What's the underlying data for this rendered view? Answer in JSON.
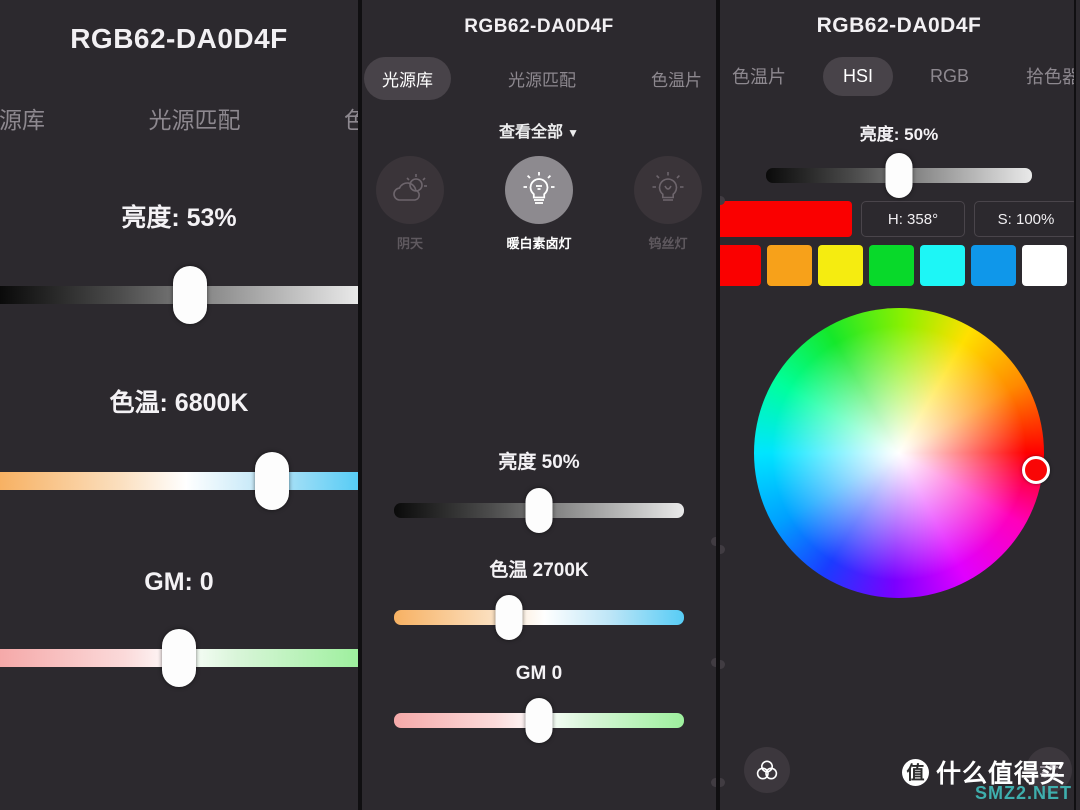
{
  "app": {
    "device_name": "RGB62-DA0D4F",
    "background": "#2c292e",
    "accent": "#f90606"
  },
  "panel1": {
    "title": "RGB62-DA0D4F",
    "tabs": [
      {
        "label": "光源库",
        "active": false
      },
      {
        "label": "光源匹配",
        "active": false
      },
      {
        "label": "色温",
        "active": false
      }
    ],
    "sliders": [
      {
        "name": "brightness",
        "label": "亮度: 53%",
        "value": 53,
        "unit": "%",
        "track": "brightness"
      },
      {
        "name": "cct",
        "label": "色温: 6800K",
        "value": 6800,
        "unit": "K",
        "track": "cct"
      },
      {
        "name": "gm",
        "label": "GM: 0",
        "value": 0,
        "unit": "",
        "track": "gm"
      }
    ]
  },
  "panel2": {
    "title": "RGB62-DA0D4F",
    "tabs": [
      {
        "label": "光源库",
        "active": true
      },
      {
        "label": "光源匹配",
        "active": false
      },
      {
        "label": "色温片",
        "active": false
      }
    ],
    "view_all": "查看全部",
    "view_all_caret": "▼",
    "presets": [
      {
        "label": "阴天",
        "icon": "cloudy-sun-icon",
        "selected": false
      },
      {
        "label": "暖白素卤灯",
        "icon": "bulb-icon",
        "selected": true
      },
      {
        "label": "钨丝灯",
        "icon": "tungsten-bulb-icon",
        "selected": false
      }
    ],
    "sliders": [
      {
        "name": "brightness",
        "label": "亮度   50%",
        "value": 50,
        "unit": "%",
        "track": "brightness"
      },
      {
        "name": "cct",
        "label": "色温   2700K",
        "value": 2700,
        "unit": "K",
        "track": "cct"
      },
      {
        "name": "gm",
        "label": "GM   0",
        "value": 0,
        "unit": "",
        "track": "gm"
      }
    ]
  },
  "panel3": {
    "title": "RGB62-DA0D4F",
    "tabs": [
      {
        "label": "色温片",
        "active": false
      },
      {
        "label": "HSI",
        "active": true
      },
      {
        "label": "RGB",
        "active": false
      },
      {
        "label": "拾色器",
        "active": false
      }
    ],
    "brightness": {
      "label": "亮度: 50%",
      "value": 50
    },
    "color_preview": "#fa0000",
    "hue_box": "H: 358°",
    "sat_box": "S: 100%",
    "swatches": [
      "#fa0000",
      "#f7a11a",
      "#f5ec10",
      "#08d92a",
      "#1df6f6",
      "#0f97ea",
      "#ffffff"
    ],
    "wheel": {
      "selected_hue": 358,
      "selected_saturation": 100,
      "dot_color": "#f90606"
    },
    "bottom_left_icon": "color-mix-icon",
    "bottom_right_icon": "slider-settings-icon"
  },
  "watermark": {
    "badge": "值",
    "text": "什么值得买",
    "sub": "SMZ2.NET"
  }
}
